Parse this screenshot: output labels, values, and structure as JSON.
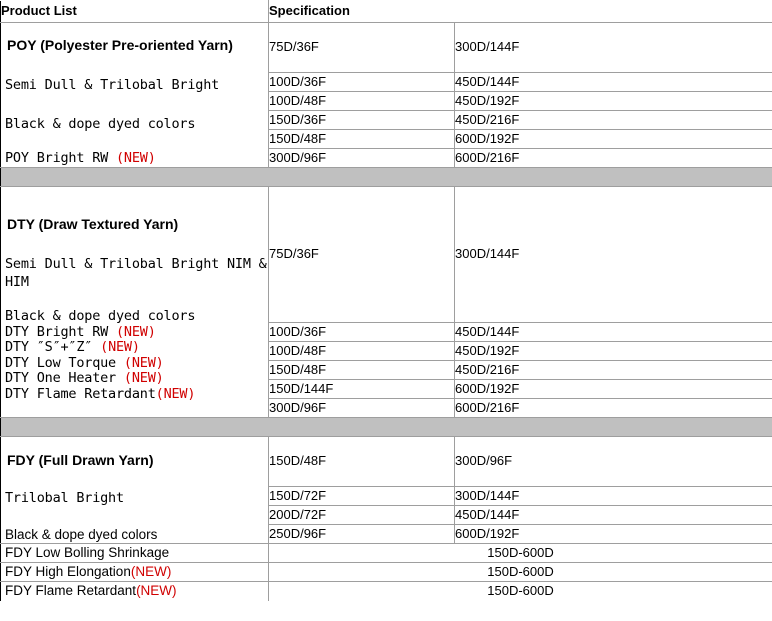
{
  "header": {
    "col_product": "Product List",
    "col_spec": "Specification"
  },
  "colors": {
    "new_badge": "#d00000",
    "separator_band": "#c0c0c0",
    "grid_line": "#9e9e9e",
    "header_rule": "#1a1a1a"
  },
  "sections": [
    {
      "id": "poy",
      "title": "POY (Polyester Pre-oriented Yarn)",
      "descriptions": [
        {
          "text": "Semi Dull & Trilobal Bright",
          "style": "mono"
        },
        {
          "text": "Black & dope dyed colors",
          "style": "mono"
        },
        {
          "text": " POY Bright RW ",
          "style": "mono",
          "badge": "(NEW)"
        }
      ],
      "specs_col1": [
        "75D/36F",
        "100D/36F",
        "100D/48F",
        "150D/36F",
        "150D/48F",
        "300D/96F"
      ],
      "specs_col2": [
        "300D/144F",
        "450D/144F",
        "450D/192F",
        "450D/216F",
        "600D/192F",
        "600D/216F"
      ]
    },
    {
      "id": "dty",
      "title": "DTY (Draw Textured Yarn)",
      "descriptions": [
        {
          "text": "Semi Dull & Trilobal Bright NIM & HIM",
          "style": "mono-wrap"
        },
        {
          "text": "Black & dope dyed colors",
          "style": "mono"
        },
        {
          "text": "DTY Bright RW ",
          "style": "mono",
          "badge": "(NEW)"
        },
        {
          "text": "DTY ″S″+″Z″ ",
          "style": "mono",
          "badge": "(NEW)"
        },
        {
          "text": "DTY Low Torque ",
          "style": "mono",
          "badge": "(NEW)"
        },
        {
          "text": "DTY One Heater ",
          "style": "mono",
          "badge": "(NEW)"
        },
        {
          "text": "DTY Flame Retardant",
          "style": "mono",
          "badge": "(NEW)"
        }
      ],
      "specs_col1": [
        "75D/36F",
        "100D/36F",
        "100D/48F",
        "150D/48F",
        "150D/144F",
        "300D/96F"
      ],
      "specs_col2": [
        "300D/144F",
        "450D/144F",
        "450D/192F",
        "450D/216F",
        "600D/192F",
        "600D/216F"
      ]
    },
    {
      "id": "fdy",
      "title": "FDY (Full Drawn Yarn)",
      "descriptions": [
        {
          "text": "Trilobal Bright",
          "style": "mono"
        },
        {
          "text": "Black & dope dyed colors",
          "style": "sans"
        },
        {
          "text": "FDY Low Bolling Shrinkage",
          "style": "sans"
        },
        {
          "text": "FDY High Elongation",
          "style": "sans",
          "badge": "(NEW)"
        },
        {
          "text": "FDY Flame Retardant",
          "style": "sans",
          "badge": "(NEW)"
        }
      ],
      "specs_col1": [
        "150D/48F",
        "150D/72F",
        "200D/72F",
        "250D/96F"
      ],
      "specs_col2": [
        "300D/96F",
        "300D/144F",
        "450D/144F",
        "600D/192F"
      ],
      "specs_spanned": [
        "150D-600D",
        "150D-600D",
        "150D-600D"
      ]
    }
  ]
}
